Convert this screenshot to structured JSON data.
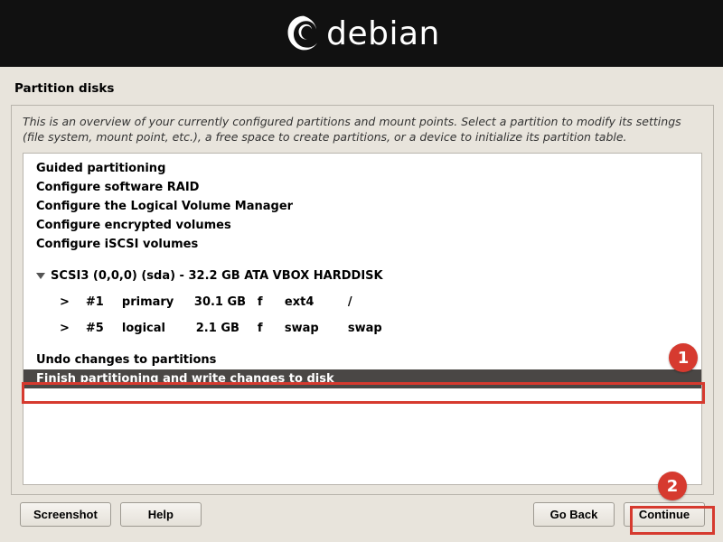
{
  "banner": {
    "brand_name": "debian"
  },
  "section_title": "Partition disks",
  "instructions": "This is an overview of your currently configured partitions and mount points. Select a partition to modify its settings (file system, mount point, etc.), a free space to create partitions, or a device to initialize its partition table.",
  "list": {
    "guided": "Guided partitioning",
    "raid": "Configure software RAID",
    "lvm": "Configure the Logical Volume Manager",
    "encrypted": "Configure encrypted volumes",
    "iscsi": "Configure iSCSI volumes",
    "disk_header": "SCSI3 (0,0,0) (sda) - 32.2 GB ATA VBOX HARDDISK",
    "p1": {
      "num": "#1",
      "type": "primary",
      "size": "30.1 GB",
      "flag": "f",
      "fs": "ext4",
      "mnt": "/"
    },
    "p5": {
      "num": "#5",
      "type": "logical",
      "size": "2.1 GB",
      "flag": "f",
      "fs": "swap",
      "mnt": "swap"
    },
    "undo": "Undo changes to partitions",
    "finish": "Finish partitioning and write changes to disk"
  },
  "buttons": {
    "screenshot": "Screenshot",
    "help": "Help",
    "go_back": "Go Back",
    "continue": "Continue"
  },
  "callouts": {
    "one": "1",
    "two": "2"
  }
}
